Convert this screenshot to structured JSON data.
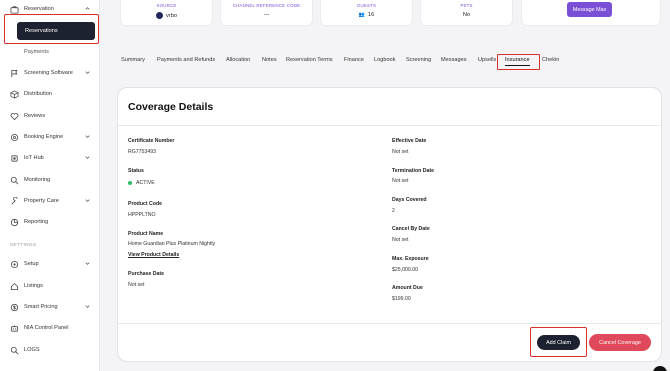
{
  "sidebar": {
    "reservation": "Reservation",
    "reservations": "Reservations",
    "payments": "Payments",
    "screening_software": "Screening Software",
    "distribution": "Distribution",
    "reviews": "Reviews",
    "booking_engine": "Booking Engine",
    "iot_hub": "IoT Hub",
    "monitoring": "Monitoring",
    "property_care": "Property Care",
    "reporting": "Reporting",
    "settings_title": "SETTINGS",
    "setup": "Setup",
    "listings": "Listings",
    "smart_pricing": "Smart Pricing",
    "nia_control_panel": "NIA Control Panel",
    "logs": "LOGS"
  },
  "topcards": {
    "source_label": "SOURCE",
    "source_value": "vrbo",
    "channel_label": "CHANNEL REFERENCE CODE",
    "channel_value": "---",
    "guests_label": "GUESTS",
    "guests_value": "16",
    "pets_label": "PETS",
    "pets_value": "No",
    "message_button": "Message Max"
  },
  "tabs": [
    "Summary",
    "Payments and Refunds",
    "Allocation",
    "Notes",
    "Reservation Terms",
    "Finance",
    "Logbook",
    "Screening",
    "Messages",
    "Upsells",
    "Insurance",
    "Chekin"
  ],
  "coverage": {
    "title": "Coverage Details",
    "certificate_label": "Certificate Number",
    "certificate_value": "RG7753493",
    "status_label": "Status",
    "status_value": "ACTIVE",
    "product_code_label": "Product Code",
    "product_code_value": "HPPPLTNO",
    "product_name_label": "Product Name",
    "product_name_value": "Home Guardian Plus Platinum Nightly",
    "view_product_details": "View Product Details",
    "purchase_date_label": "Purchase Date",
    "purchase_date_value": "Not set",
    "effective_date_label": "Effective Date",
    "effective_date_value": "Not set",
    "termination_date_label": "Termination Date",
    "termination_date_value": "Not set",
    "days_covered_label": "Days Covered",
    "days_covered_value": "2",
    "cancel_by_label": "Cancel By Date",
    "cancel_by_value": "Not set",
    "max_exposure_label": "Max. Exposure",
    "max_exposure_value": "$25,000.00",
    "amount_due_label": "Amount Due",
    "amount_due_value": "$199.00",
    "add_claim": "Add Claim",
    "cancel_coverage": "Cancel Coverage"
  },
  "colors": {
    "accent": "#7a4fd6",
    "dark": "#1d2230",
    "danger": "#e0495b",
    "status_active": "#2ebd6b",
    "highlight": "#d9302a"
  }
}
